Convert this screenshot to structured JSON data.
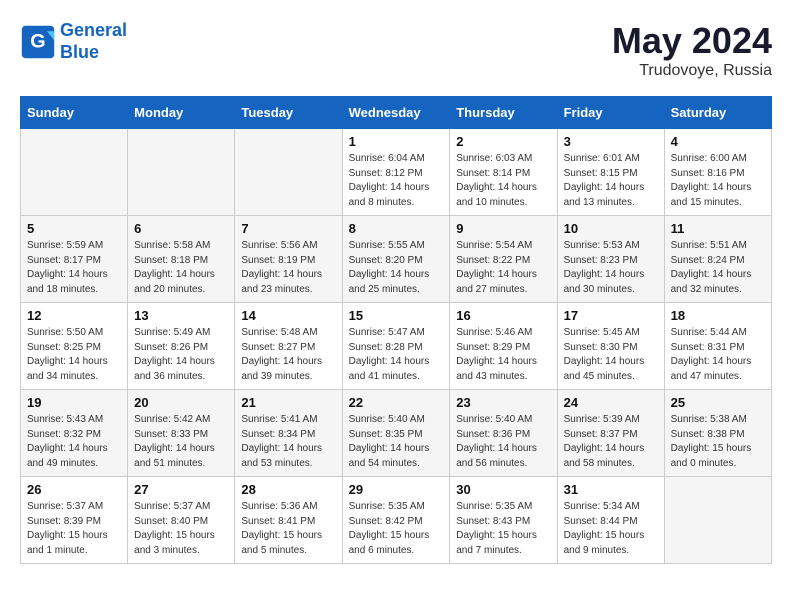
{
  "header": {
    "logo_line1": "General",
    "logo_line2": "Blue",
    "month": "May 2024",
    "location": "Trudovoye, Russia"
  },
  "weekdays": [
    "Sunday",
    "Monday",
    "Tuesday",
    "Wednesday",
    "Thursday",
    "Friday",
    "Saturday"
  ],
  "weeks": [
    [
      {
        "day": "",
        "info": ""
      },
      {
        "day": "",
        "info": ""
      },
      {
        "day": "",
        "info": ""
      },
      {
        "day": "1",
        "info": "Sunrise: 6:04 AM\nSunset: 8:12 PM\nDaylight: 14 hours\nand 8 minutes."
      },
      {
        "day": "2",
        "info": "Sunrise: 6:03 AM\nSunset: 8:14 PM\nDaylight: 14 hours\nand 10 minutes."
      },
      {
        "day": "3",
        "info": "Sunrise: 6:01 AM\nSunset: 8:15 PM\nDaylight: 14 hours\nand 13 minutes."
      },
      {
        "day": "4",
        "info": "Sunrise: 6:00 AM\nSunset: 8:16 PM\nDaylight: 14 hours\nand 15 minutes."
      }
    ],
    [
      {
        "day": "5",
        "info": "Sunrise: 5:59 AM\nSunset: 8:17 PM\nDaylight: 14 hours\nand 18 minutes."
      },
      {
        "day": "6",
        "info": "Sunrise: 5:58 AM\nSunset: 8:18 PM\nDaylight: 14 hours\nand 20 minutes."
      },
      {
        "day": "7",
        "info": "Sunrise: 5:56 AM\nSunset: 8:19 PM\nDaylight: 14 hours\nand 23 minutes."
      },
      {
        "day": "8",
        "info": "Sunrise: 5:55 AM\nSunset: 8:20 PM\nDaylight: 14 hours\nand 25 minutes."
      },
      {
        "day": "9",
        "info": "Sunrise: 5:54 AM\nSunset: 8:22 PM\nDaylight: 14 hours\nand 27 minutes."
      },
      {
        "day": "10",
        "info": "Sunrise: 5:53 AM\nSunset: 8:23 PM\nDaylight: 14 hours\nand 30 minutes."
      },
      {
        "day": "11",
        "info": "Sunrise: 5:51 AM\nSunset: 8:24 PM\nDaylight: 14 hours\nand 32 minutes."
      }
    ],
    [
      {
        "day": "12",
        "info": "Sunrise: 5:50 AM\nSunset: 8:25 PM\nDaylight: 14 hours\nand 34 minutes."
      },
      {
        "day": "13",
        "info": "Sunrise: 5:49 AM\nSunset: 8:26 PM\nDaylight: 14 hours\nand 36 minutes."
      },
      {
        "day": "14",
        "info": "Sunrise: 5:48 AM\nSunset: 8:27 PM\nDaylight: 14 hours\nand 39 minutes."
      },
      {
        "day": "15",
        "info": "Sunrise: 5:47 AM\nSunset: 8:28 PM\nDaylight: 14 hours\nand 41 minutes."
      },
      {
        "day": "16",
        "info": "Sunrise: 5:46 AM\nSunset: 8:29 PM\nDaylight: 14 hours\nand 43 minutes."
      },
      {
        "day": "17",
        "info": "Sunrise: 5:45 AM\nSunset: 8:30 PM\nDaylight: 14 hours\nand 45 minutes."
      },
      {
        "day": "18",
        "info": "Sunrise: 5:44 AM\nSunset: 8:31 PM\nDaylight: 14 hours\nand 47 minutes."
      }
    ],
    [
      {
        "day": "19",
        "info": "Sunrise: 5:43 AM\nSunset: 8:32 PM\nDaylight: 14 hours\nand 49 minutes."
      },
      {
        "day": "20",
        "info": "Sunrise: 5:42 AM\nSunset: 8:33 PM\nDaylight: 14 hours\nand 51 minutes."
      },
      {
        "day": "21",
        "info": "Sunrise: 5:41 AM\nSunset: 8:34 PM\nDaylight: 14 hours\nand 53 minutes."
      },
      {
        "day": "22",
        "info": "Sunrise: 5:40 AM\nSunset: 8:35 PM\nDaylight: 14 hours\nand 54 minutes."
      },
      {
        "day": "23",
        "info": "Sunrise: 5:40 AM\nSunset: 8:36 PM\nDaylight: 14 hours\nand 56 minutes."
      },
      {
        "day": "24",
        "info": "Sunrise: 5:39 AM\nSunset: 8:37 PM\nDaylight: 14 hours\nand 58 minutes."
      },
      {
        "day": "25",
        "info": "Sunrise: 5:38 AM\nSunset: 8:38 PM\nDaylight: 15 hours\nand 0 minutes."
      }
    ],
    [
      {
        "day": "26",
        "info": "Sunrise: 5:37 AM\nSunset: 8:39 PM\nDaylight: 15 hours\nand 1 minute."
      },
      {
        "day": "27",
        "info": "Sunrise: 5:37 AM\nSunset: 8:40 PM\nDaylight: 15 hours\nand 3 minutes."
      },
      {
        "day": "28",
        "info": "Sunrise: 5:36 AM\nSunset: 8:41 PM\nDaylight: 15 hours\nand 5 minutes."
      },
      {
        "day": "29",
        "info": "Sunrise: 5:35 AM\nSunset: 8:42 PM\nDaylight: 15 hours\nand 6 minutes."
      },
      {
        "day": "30",
        "info": "Sunrise: 5:35 AM\nSunset: 8:43 PM\nDaylight: 15 hours\nand 7 minutes."
      },
      {
        "day": "31",
        "info": "Sunrise: 5:34 AM\nSunset: 8:44 PM\nDaylight: 15 hours\nand 9 minutes."
      },
      {
        "day": "",
        "info": ""
      }
    ]
  ]
}
